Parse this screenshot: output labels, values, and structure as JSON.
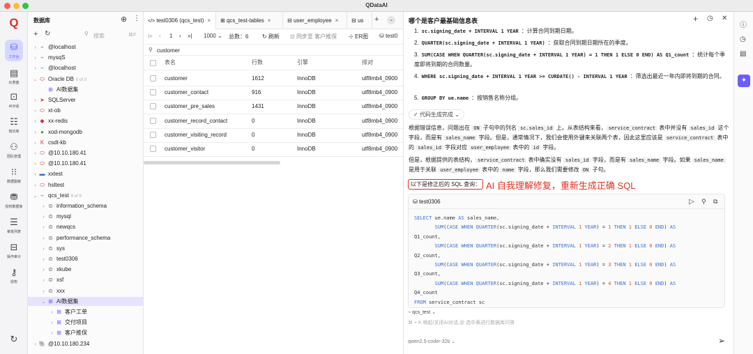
{
  "app": {
    "title": "QDataAI"
  },
  "rail": {
    "items": [
      {
        "icon": "logo-q-icon",
        "label": ""
      },
      {
        "icon": "database-icon",
        "label": "工作台"
      },
      {
        "icon": "dashboard-icon",
        "label": "仪表盘"
      },
      {
        "icon": "ai-chat-icon",
        "label": "AI对话"
      },
      {
        "icon": "knowledge-icon",
        "label": "知识库"
      },
      {
        "icon": "team-icon",
        "label": "团队管理"
      },
      {
        "icon": "data-mask-icon",
        "label": "数据脱敏"
      },
      {
        "icon": "auth-icon",
        "label": "授权数据库"
      },
      {
        "icon": "approval-icon",
        "label": "审批列表"
      },
      {
        "icon": "audit-icon",
        "label": "操作审计"
      },
      {
        "icon": "key-icon",
        "label": "授权"
      },
      {
        "icon": "refresh-icon",
        "label": ""
      }
    ]
  },
  "tree": {
    "title": "数据库",
    "search_placeholder": "搜索",
    "search_shortcut": "⌘F",
    "items": [
      {
        "label": "@localhost",
        "depth": 0,
        "chev": "›",
        "icon": "⌁",
        "color": "#6b8bd6"
      },
      {
        "label": "mysqS",
        "depth": 0,
        "chev": "›",
        "icon": "⌁",
        "color": "#6b8bd6"
      },
      {
        "label": "@localhost",
        "depth": 0,
        "chev": "›",
        "icon": "⌁",
        "color": "#6b8bd6"
      },
      {
        "label": "Oracle DB",
        "depth": 0,
        "chev": "⌄",
        "icon": "⬭",
        "color": "#d43b3b",
        "count": "0 of 0"
      },
      {
        "label": "AI数据集",
        "depth": 1,
        "chev": "",
        "icon": "⊞",
        "color": "#6a5cff"
      },
      {
        "label": "SQLServer",
        "depth": 0,
        "chev": "›",
        "icon": "➤",
        "color": "#d43b3b"
      },
      {
        "label": "xt-ob",
        "depth": 0,
        "chev": "›",
        "icon": "⬭",
        "color": "#d43b3b"
      },
      {
        "label": "xx-redis",
        "depth": 0,
        "chev": "›",
        "icon": "◆",
        "color": "#c7352d"
      },
      {
        "label": "xod-mongodb",
        "depth": 0,
        "chev": "›",
        "icon": "●",
        "color": "#3f9d4a"
      },
      {
        "label": "csdt-kb",
        "depth": 0,
        "chev": "›",
        "icon": "K",
        "color": "#e03a3a"
      },
      {
        "label": "@10.10.180.41",
        "depth": 0,
        "chev": "›",
        "icon": "⬭",
        "color": "#d43b3b"
      },
      {
        "label": "@10.10.180.41",
        "depth": 0,
        "chev": "›",
        "icon": "⬭",
        "color": "#d43b3b"
      },
      {
        "label": "xxtest",
        "depth": 0,
        "chev": "›",
        "icon": "▬",
        "color": "#2f6bd1"
      },
      {
        "label": "hsltest",
        "depth": 0,
        "chev": "›",
        "icon": "⬭",
        "color": "#d43b3b"
      },
      {
        "label": "qcs_test",
        "depth": 0,
        "chev": "⌄",
        "icon": "⌁",
        "color": "#6b8bd6",
        "count": "9 of 9"
      },
      {
        "label": "information_schema",
        "depth": 1,
        "chev": "›",
        "icon": "⊜",
        "color": "#777"
      },
      {
        "label": "mysql",
        "depth": 1,
        "chev": "›",
        "icon": "⊜",
        "color": "#777"
      },
      {
        "label": "newqcs",
        "depth": 1,
        "chev": "›",
        "icon": "⊜",
        "color": "#777"
      },
      {
        "label": "performance_schema",
        "depth": 1,
        "chev": "›",
        "icon": "⊜",
        "color": "#777"
      },
      {
        "label": "sys",
        "depth": 1,
        "chev": "›",
        "icon": "⊜",
        "color": "#777"
      },
      {
        "label": "test0306",
        "depth": 1,
        "chev": "›",
        "icon": "⊜",
        "color": "#777"
      },
      {
        "label": "xkube",
        "depth": 1,
        "chev": "›",
        "icon": "⊜",
        "color": "#777"
      },
      {
        "label": "xsf",
        "depth": 1,
        "chev": "›",
        "icon": "⊜",
        "color": "#777"
      },
      {
        "label": "xxx",
        "depth": 1,
        "chev": "›",
        "icon": "⊜",
        "color": "#777"
      },
      {
        "label": "AI数据集",
        "depth": 1,
        "chev": "⌄",
        "icon": "⊞",
        "color": "#6a5cff",
        "selected": true
      },
      {
        "label": "客户工单",
        "depth": 2,
        "chev": "›",
        "icon": "⊞",
        "color": "#6a5cff"
      },
      {
        "label": "交付项目",
        "depth": 2,
        "chev": "›",
        "icon": "⊞",
        "color": "#6a5cff"
      },
      {
        "label": "客户推保",
        "depth": 2,
        "chev": "›",
        "icon": "⊞",
        "color": "#6a5cff"
      },
      {
        "label": "@10.10.180.234",
        "depth": 0,
        "chev": "›",
        "icon": "🐘",
        "color": "#336791"
      }
    ]
  },
  "tabs": [
    {
      "label": "test0306 (qcs_test)",
      "icon": "</>",
      "active": true
    },
    {
      "label": "qcs_test-tables",
      "icon": "⊞",
      "active": false
    },
    {
      "label": "user_employee",
      "icon": "⊟",
      "active": false
    },
    {
      "label": "us",
      "icon": "⊟",
      "active": false
    }
  ],
  "toolbar": {
    "page": "1",
    "page_size": "1000",
    "total": "总数：6",
    "refresh": "刷新",
    "sync": "同步至 客户推保",
    "er": "ER图",
    "conn": "test0"
  },
  "filter": {
    "value": "customer"
  },
  "grid": {
    "columns": [
      "表名",
      "行数",
      "引擎",
      "排对"
    ],
    "rows": [
      [
        "customer",
        "1612",
        "InnoDB",
        "utf8mb4_0900"
      ],
      [
        "customer_contact",
        "916",
        "InnoDB",
        "utf8mb4_0900"
      ],
      [
        "customer_pre_sales",
        "1431",
        "InnoDB",
        "utf8mb4_0900"
      ],
      [
        "customer_record_contact",
        "0",
        "InnoDB",
        "utf8mb4_0900"
      ],
      [
        "customer_visiting_record",
        "0",
        "InnoDB",
        "utf8mb4_0900"
      ],
      [
        "customer_visitor",
        "0",
        "InnoDB",
        "utf8mb4_0900"
      ]
    ]
  },
  "ai": {
    "title": "哪个是客户最基础信息表",
    "steps": [
      {
        "num": "1.",
        "code": "sc.signing_date + INTERVAL 1 YEAR",
        "text": "：计算合同到期日期。"
      },
      {
        "num": "2.",
        "code": "QUARTER(sc.signing_date + INTERVAL 1 YEAR)",
        "text": "：获取合同到期日期所在的季度。"
      },
      {
        "num": "3.",
        "code": "SUM(CASE WHEN QUARTER(sc.signing_date + INTERVAL 1 YEAR) = 1 THEN 1 ELSE 0 END) AS Q1_count",
        "text": "：统计每个季度即将到期的合同数量。"
      },
      {
        "num": "4.",
        "code": "WHERE sc.signing_date + INTERVAL 1 YEAR >= CURDATE() - INTERVAL 1 YEAR",
        "text": "：筛选出最近一年内即将到期的合同。"
      },
      {
        "num": "5.",
        "code": "GROUP BY ue.name",
        "text": "：按销售名称分组。"
      }
    ],
    "done_label": "代码生成完成",
    "para1": "根据错误信息，问题出在 ON 子句中的列名 sc.sales_id 上。从表结构来看，service_contract 表中并没有 sales_id 这个字段，而是有 sales_name 字段。但是，通常情况下，我们会使用外键来关联两个表，因此这里应该是 service_contract 表中的 sales_id 字段对应 user_employee 表中的 id 字段。",
    "para2": "但是，根据提供的表结构，service_contract 表中确实没有 sales_id 字段，而是有 sales_name 字段。如果 sales_name 是用于关联 user_employee 表中的 name 字段，那么我们需要修改 ON 子句。",
    "fixed_label": "以下是修正后的 SQL 查询：",
    "annotation": "AI 自我理解修复，重新生成正确 SQL",
    "sql_db": "test0306",
    "sql_lines": [
      "SELECT ue.name AS sales_name,",
      "       SUM(CASE WHEN QUARTER(sc.signing_date + INTERVAL 1 YEAR) = 1 THEN 1 ELSE 0 END) AS",
      "Q1_count,",
      "       SUM(CASE WHEN QUARTER(sc.signing_date + INTERVAL 1 YEAR) = 2 THEN 1 ELSE 0 END) AS",
      "Q2_count,",
      "       SUM(CASE WHEN QUARTER(sc.signing_date + INTERVAL 1 YEAR) = 3 THEN 1 ELSE 0 END) AS",
      "Q3_count,",
      "       SUM(CASE WHEN QUARTER(sc.signing_date + INTERVAL 1 YEAR) = 4 THEN 1 ELSE 0 END) AS",
      "Q4_count",
      "FROM service_contract sc"
    ],
    "context_db": "qcs_test",
    "input_placeholder": "⌘ + K 唤起/关闭AI对话,@ 选中表进行数据库问答",
    "model": "qwen2.5-coder-32b"
  },
  "colors": {
    "accent": "#6a5cff",
    "annotation": "#e0301e"
  }
}
